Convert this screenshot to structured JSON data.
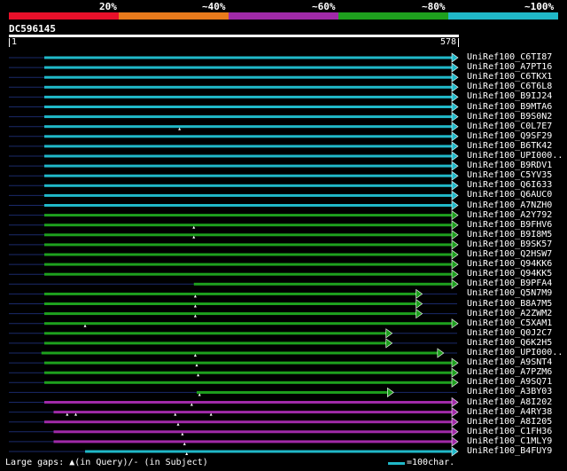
{
  "scale": {
    "labels": [
      "20%",
      "~40%",
      "~60%",
      "~80%",
      "~100%"
    ],
    "colors": [
      "#e8102a",
      "#e87a1c",
      "#a02aa8",
      "#1ea01e",
      "#20b8c8"
    ]
  },
  "query": {
    "id": "DC596145",
    "start": "1",
    "end": "578",
    "length": 578
  },
  "legend": {
    "gaps_text": "Large gaps: ▲(in Query)/‐ (in Subject)",
    "scale_text": "=100char."
  },
  "hits": [
    {
      "label": "UniRef100_C6TI87",
      "color": "#20b8c8",
      "qs": 1,
      "qe": 578,
      "markers": []
    },
    {
      "label": "UniRef100_A7PT16",
      "color": "#20b8c8",
      "qs": 1,
      "qe": 578,
      "markers": []
    },
    {
      "label": "UniRef100_C6TKX1",
      "color": "#20b8c8",
      "qs": 1,
      "qe": 578,
      "markers": []
    },
    {
      "label": "UniRef100_C6T6L8",
      "color": "#20b8c8",
      "qs": 1,
      "qe": 578,
      "markers": []
    },
    {
      "label": "UniRef100_B9IJ24",
      "color": "#20b8c8",
      "qs": 1,
      "qe": 578,
      "markers": []
    },
    {
      "label": "UniRef100_B9MTA6",
      "color": "#20b8c8",
      "qs": 1,
      "qe": 578,
      "markers": []
    },
    {
      "label": "UniRef100_B9S0N2",
      "color": "#20b8c8",
      "qs": 1,
      "qe": 578,
      "markers": []
    },
    {
      "label": "UniRef100_C0L7E7",
      "color": "#20b8c8",
      "qs": 1,
      "qe": 578,
      "markers": [
        190
      ]
    },
    {
      "label": "UniRef100_Q9SF29",
      "color": "#20b8c8",
      "qs": 1,
      "qe": 578,
      "markers": []
    },
    {
      "label": "UniRef100_B6TK42",
      "color": "#20b8c8",
      "qs": 1,
      "qe": 578,
      "markers": []
    },
    {
      "label": "UniRef100_UPI000..",
      "color": "#20b8c8",
      "qs": 1,
      "qe": 578,
      "markers": []
    },
    {
      "label": "UniRef100_B9RDV1",
      "color": "#20b8c8",
      "qs": 1,
      "qe": 578,
      "markers": []
    },
    {
      "label": "UniRef100_C5YV35",
      "color": "#20b8c8",
      "qs": 1,
      "qe": 578,
      "markers": []
    },
    {
      "label": "UniRef100_Q6I633",
      "color": "#20b8c8",
      "qs": 1,
      "qe": 578,
      "markers": []
    },
    {
      "label": "UniRef100_Q6AUC0",
      "color": "#20b8c8",
      "qs": 1,
      "qe": 578,
      "markers": []
    },
    {
      "label": "UniRef100_A7NZH0",
      "color": "#20b8c8",
      "qs": 1,
      "qe": 578,
      "markers": []
    },
    {
      "label": "UniRef100_A2Y792",
      "color": "#1ea01e",
      "qs": 1,
      "qe": 578,
      "markers": []
    },
    {
      "label": "UniRef100_B9FHV6",
      "color": "#1ea01e",
      "qs": 1,
      "qe": 578,
      "markers": [
        210
      ]
    },
    {
      "label": "UniRef100_B9I8M5",
      "color": "#1ea01e",
      "qs": 1,
      "qe": 578,
      "markers": [
        210
      ]
    },
    {
      "label": "UniRef100_B9SK57",
      "color": "#1ea01e",
      "qs": 1,
      "qe": 578,
      "markers": []
    },
    {
      "label": "UniRef100_Q2HSW7",
      "color": "#1ea01e",
      "qs": 1,
      "qe": 578,
      "markers": []
    },
    {
      "label": "UniRef100_Q94KK6",
      "color": "#1ea01e",
      "qs": 1,
      "qe": 578,
      "markers": []
    },
    {
      "label": "UniRef100_Q94KK5",
      "color": "#1ea01e",
      "qs": 1,
      "qe": 578,
      "markers": []
    },
    {
      "label": "UniRef100_B9PFA4",
      "color": "#1ea01e",
      "qs": 210,
      "qe": 578,
      "markers": []
    },
    {
      "label": "UniRef100_Q5N7M9",
      "color": "#1ea01e",
      "qs": 1,
      "qe": 528,
      "markers": [
        212
      ]
    },
    {
      "label": "UniRef100_B8A7M5",
      "color": "#1ea01e",
      "qs": 1,
      "qe": 528,
      "markers": [
        212
      ]
    },
    {
      "label": "UniRef100_A2ZWM2",
      "color": "#1ea01e",
      "qs": 1,
      "qe": 528,
      "markers": [
        212
      ]
    },
    {
      "label": "UniRef100_C5XAM1",
      "color": "#1ea01e",
      "qs": 1,
      "qe": 578,
      "markers": [
        58
      ]
    },
    {
      "label": "UniRef100_Q0J2C7",
      "color": "#1ea01e",
      "qs": 1,
      "qe": 486,
      "markers": []
    },
    {
      "label": "UniRef100_Q6K2H5",
      "color": "#1ea01e",
      "qs": 1,
      "qe": 486,
      "markers": []
    },
    {
      "label": "UniRef100_UPI000..",
      "color": "#1ea01e",
      "qs": -3,
      "qe": 558,
      "markers": [
        212
      ]
    },
    {
      "label": "UniRef100_A9SNT4",
      "color": "#1ea01e",
      "qs": 1,
      "qe": 578,
      "markers": [
        214
      ]
    },
    {
      "label": "UniRef100_A7PZM6",
      "color": "#1ea01e",
      "qs": 1,
      "qe": 578,
      "markers": [
        216
      ]
    },
    {
      "label": "UniRef100_A9SQ71",
      "color": "#1ea01e",
      "qs": 1,
      "qe": 578,
      "markers": []
    },
    {
      "label": "UniRef100_A3BY03",
      "color": "#1ea01e",
      "qs": 214,
      "qe": 488,
      "markers": [
        218
      ]
    },
    {
      "label": "UniRef100_A8I202",
      "color": "#a02aa8",
      "qs": 1,
      "qe": 578,
      "markers": [
        207
      ]
    },
    {
      "label": "UniRef100_A4RY38",
      "color": "#a02aa8",
      "qs": 14,
      "qe": 578,
      "markers": [
        33,
        45,
        184,
        234
      ]
    },
    {
      "label": "UniRef100_A8I205",
      "color": "#a02aa8",
      "qs": 1,
      "qe": 578,
      "markers": [
        188
      ]
    },
    {
      "label": "UniRef100_C1FH36",
      "color": "#a02aa8",
      "qs": 14,
      "qe": 578,
      "markers": [
        194
      ]
    },
    {
      "label": "UniRef100_C1MLY9",
      "color": "#a02aa8",
      "qs": 14,
      "qe": 578,
      "markers": [
        197
      ]
    },
    {
      "label": "UniRef100_B4FUY9",
      "color": "#20b8c8",
      "qs": 58,
      "qe": 578,
      "markers": [
        200
      ]
    }
  ]
}
